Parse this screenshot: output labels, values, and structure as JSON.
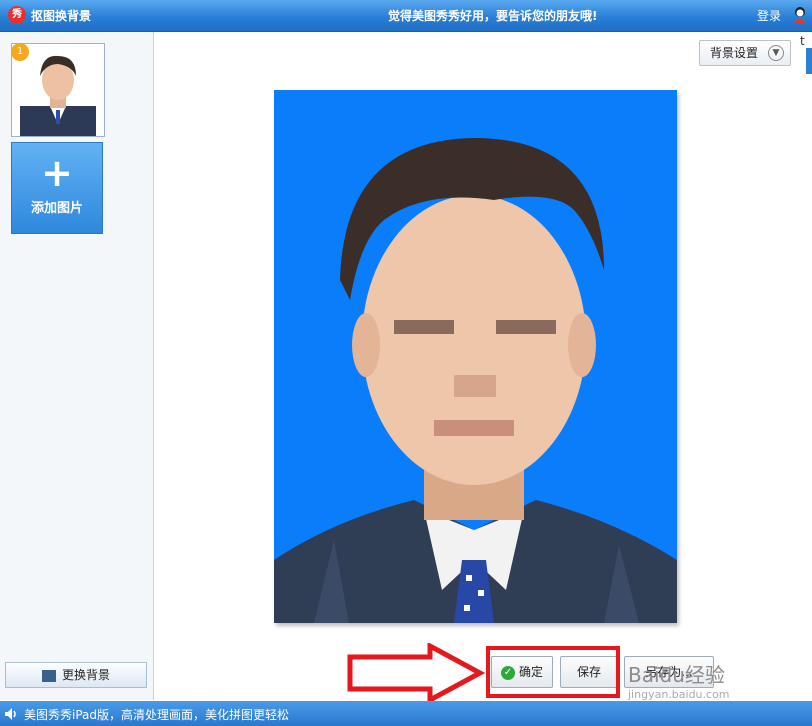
{
  "titlebar": {
    "logo_char": "秀",
    "title": "抠图换背景",
    "slogan": "觉得美图秀秀好用，要告诉您的朋友哦!",
    "login": "登录"
  },
  "sidebar": {
    "thumb_badge": "1",
    "add_label": "添加图片",
    "add_symbol": "+",
    "change_bg_label": "更换背景"
  },
  "main": {
    "bg_settings_label": "背景设置",
    "right_edge_char": "t",
    "photo_bg_color": "#0a7dfb"
  },
  "actions": {
    "ok_label": "确定",
    "save_label": "保存",
    "save_as_label": "另存为..."
  },
  "status": {
    "text": "美图秀秀iPad版，高清处理画面，美化拼图更轻松"
  },
  "watermark": {
    "text": "Baidu经验",
    "url": "jingyan.baidu.com"
  },
  "colors": {
    "title_bar": "#2a7fd6",
    "highlight": "#e5181e",
    "add_button": "#2f88dd"
  }
}
